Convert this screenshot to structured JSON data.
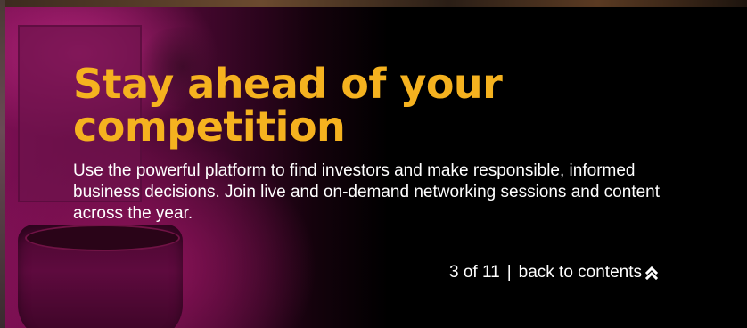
{
  "hero": {
    "title": "Stay ahead of your competition",
    "description": "Use the powerful platform to find investors and make responsible, informed business decisions. Join live and on-demand networking sessions and content across the year."
  },
  "pager": {
    "current": "3 of 11",
    "separator": "|",
    "back_label": "back to contents",
    "back_icon": "double-chevron-up-icon"
  },
  "colors": {
    "title": "#f5b21f",
    "text": "#ffffff",
    "background": "#000000",
    "photo_tint": "#7a0f52"
  }
}
